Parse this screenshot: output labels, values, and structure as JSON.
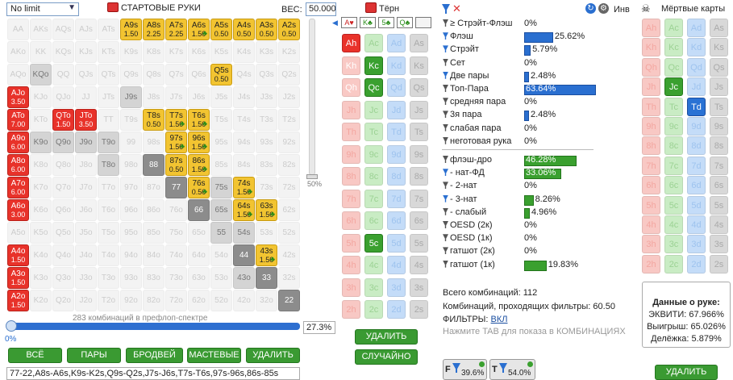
{
  "left": {
    "select": "No limit",
    "title": "СТАРТОВЫЕ РУКИ",
    "weight_label": "ВЕС:",
    "weight_value": "50.000",
    "slider_label": "50%",
    "status": "283 комбинаций в префлоп-спектре",
    "range_pct": "27.3%",
    "zero_pct": "0%",
    "buttons": [
      "ВСЁ",
      "ПАРЫ",
      "БРОДВЕЙ",
      "МАСТЕВЫЕ",
      "УДАЛИТЬ"
    ],
    "range_text": "77-22,A8s-A6s,K9s-K2s,Q9s-Q2s,J7s-J6s,T7s-T6s,97s-96s,86s-85s"
  },
  "grid": [
    [
      "AA",
      "AKs",
      "AQs",
      "AJs",
      "ATs",
      "A9s 1.50",
      "A8s 2.25",
      "A7s 2.25",
      "A6s 1.50",
      "A5s 0.50",
      "A4s 0.50",
      "A3s 0.50",
      "A2s 0.50"
    ],
    [
      "AKo",
      "KK",
      "KQs",
      "KJs",
      "KTs",
      "K9s",
      "K8s",
      "K7s",
      "K6s",
      "K5s",
      "K4s",
      "K3s",
      "K2s"
    ],
    [
      "AQo",
      "KQo",
      "QQ",
      "QJs",
      "QTs",
      "Q9s",
      "Q8s",
      "Q7s",
      "Q6s",
      "Q5s 0.50",
      "Q4s",
      "Q3s",
      "Q2s"
    ],
    [
      "AJo 3.50",
      "KJo",
      "QJo",
      "JJ",
      "JTs",
      "J9s",
      "J8s",
      "J7s",
      "J6s",
      "J5s",
      "J4s",
      "J3s",
      "J2s"
    ],
    [
      "ATo 7.00",
      "KTo",
      "QTo 1.50",
      "JTo 3.50",
      "TT",
      "T9s",
      "T8s 0.50",
      "T7s 1.50",
      "T6s 1.50",
      "T5s",
      "T4s",
      "T3s",
      "T2s"
    ],
    [
      "A9o 6.00",
      "K9o",
      "Q9o",
      "J9o",
      "T9o",
      "99",
      "98s",
      "97s 1.50",
      "96s 1.50",
      "95s",
      "94s",
      "93s",
      "92s"
    ],
    [
      "A8o 6.00",
      "K8o",
      "Q8o",
      "J8o",
      "T8o",
      "98o",
      "88",
      "87s 0.50",
      "86s 1.50",
      "85s",
      "84s",
      "83s",
      "82s"
    ],
    [
      "A7o 6.00",
      "K7o",
      "Q7o",
      "J7o",
      "T7o",
      "97o",
      "87o",
      "77",
      "76s 0.50",
      "75s",
      "74s 1.50",
      "73s",
      "72s"
    ],
    [
      "A6o 3.00",
      "K6o",
      "Q6o",
      "J6o",
      "T6o",
      "96o",
      "86o",
      "76o",
      "66",
      "65s",
      "64s 1.50",
      "63s 1.50",
      "62s"
    ],
    [
      "A5o",
      "K5o",
      "Q5o",
      "J5o",
      "T5o",
      "95o",
      "85o",
      "75o",
      "65o",
      "55",
      "54s",
      "53s",
      "52s"
    ],
    [
      "A4o 1.50",
      "K4o",
      "Q4o",
      "J4o",
      "T4o",
      "94o",
      "84o",
      "74o",
      "64o",
      "54o",
      "44",
      "43s 1.50",
      "42s"
    ],
    [
      "A3o 1.50",
      "K3o",
      "Q3o",
      "J3o",
      "T3o",
      "93o",
      "83o",
      "73o",
      "63o",
      "53o",
      "43o",
      "33",
      "32s"
    ],
    [
      "A2o 1.50",
      "K2o",
      "Q2o",
      "J2o",
      "T2o",
      "92o",
      "82o",
      "72o",
      "62o",
      "52o",
      "42o",
      "32o",
      "22"
    ]
  ],
  "board": {
    "title": "Тёрн",
    "mini": [
      "A♥",
      "K♣",
      "5♣",
      "Q♣"
    ],
    "ranks": [
      "A",
      "K",
      "Q",
      "J",
      "T",
      "9",
      "8",
      "7",
      "6",
      "5",
      "4",
      "3",
      "2"
    ],
    "del": "УДАЛИТЬ",
    "rnd": "СЛУЧАЙНО"
  },
  "stats": {
    "inv_label": "Инв",
    "rows1": [
      {
        "t": "≥ Стрэйт-Флэш",
        "v": "0%"
      },
      {
        "t": "Флэш",
        "v": "25.62%",
        "bar": 25.62,
        "c": "b"
      },
      {
        "t": "Стрэйт",
        "v": "5.79%",
        "bar": 5.79,
        "c": "b"
      },
      {
        "t": "Сет",
        "v": "0%"
      },
      {
        "t": "Две пары",
        "v": "2.48%",
        "bar": 2.48,
        "c": "b"
      },
      {
        "t": "Топ-Пара",
        "v": "63.64%",
        "bar": 63.64,
        "c": "b",
        "inside": true
      },
      {
        "t": "средняя пара",
        "v": "0%"
      },
      {
        "t": "3я пара",
        "v": "2.48%",
        "bar": 2.48,
        "c": "b"
      },
      {
        "t": "слабая пара",
        "v": "0%"
      },
      {
        "t": "неготовая рука",
        "v": "0%"
      }
    ],
    "rows2": [
      {
        "t": "флэш-дро",
        "v": "46.28%",
        "bar": 46.28,
        "c": "g",
        "inside": true
      },
      {
        "t": "- нат-ФД",
        "v": "33.06%",
        "bar": 33.06,
        "c": "g",
        "inside": true
      },
      {
        "t": "- 2-нат",
        "v": "0%"
      },
      {
        "t": "- 3-нат",
        "v": "8.26%",
        "bar": 8.26,
        "c": "g"
      },
      {
        "t": "- слабый",
        "v": "4.96%",
        "bar": 4.96,
        "c": "g"
      },
      {
        "t": "OESD (2к)",
        "v": "0%"
      },
      {
        "t": "OESD (1к)",
        "v": "0%"
      },
      {
        "t": "гатшот (2к)",
        "v": "0%"
      },
      {
        "t": "гатшот (1к)",
        "v": "19.83%",
        "bar": 19.83,
        "c": "g"
      }
    ],
    "total": "Всего комбинаций: 112",
    "passed": "Комбинаций, проходящих фильтры: 60.50",
    "filters_lbl": "ФИЛЬТРЫ:",
    "filters_val": "ВКЛ",
    "hint": "Нажмите TAB для показа в КОМБИНАЦИЯХ",
    "g1": "39.6%",
    "g2": "54.0%"
  },
  "dead": {
    "title": "Мёртвые карты",
    "hand_title": "Данные о руке:",
    "equity": "ЭКВИТИ: 67.966%",
    "win": "Выигрыш: 65.026%",
    "tie": "Делёжка: 5.879%",
    "del": "УДАЛИТЬ"
  }
}
